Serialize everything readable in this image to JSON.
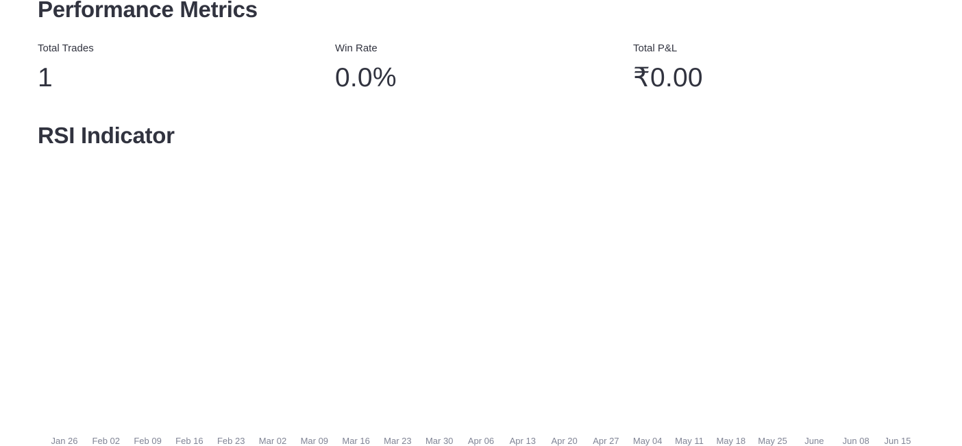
{
  "performance": {
    "title": "Performance Metrics",
    "metrics": [
      {
        "label": "Total Trades",
        "value": "1"
      },
      {
        "label": "Win Rate",
        "value": "0.0%"
      },
      {
        "label": "Total P&L",
        "value": "₹0.00"
      }
    ]
  },
  "rsi": {
    "title": "RSI Indicator"
  },
  "chart_data": {
    "type": "line",
    "title": "",
    "xlabel": "",
    "ylabel": "",
    "x_tick_labels": [
      "Jan 26",
      "Feb 02",
      "Feb 09",
      "Feb 16",
      "Feb 23",
      "Mar 02",
      "Mar 09",
      "Mar 16",
      "Mar 23",
      "Mar 30",
      "Apr 06",
      "Apr 13",
      "Apr 20",
      "Apr 27",
      "May 04",
      "May 11",
      "May 18",
      "May 25",
      "June",
      "Jun 08",
      "Jun 15"
    ],
    "series": [],
    "grid": false
  },
  "colors": {
    "text": "#31333f",
    "tick_text": "#808495",
    "background": "#ffffff"
  }
}
